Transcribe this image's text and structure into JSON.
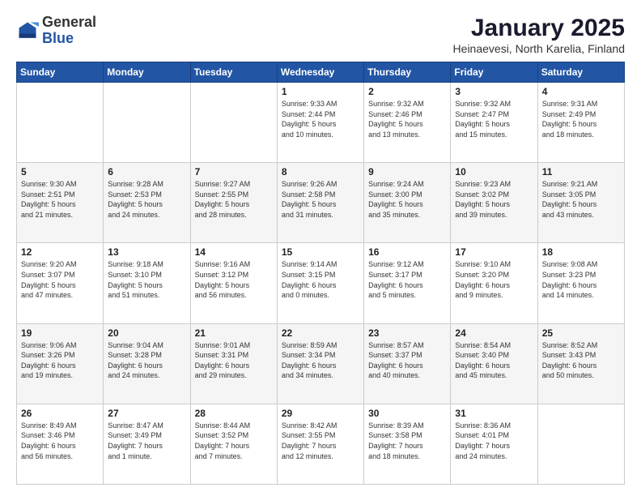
{
  "header": {
    "logo": {
      "general": "General",
      "blue": "Blue"
    },
    "title": "January 2025",
    "subtitle": "Heinaevesi, North Karelia, Finland"
  },
  "weekdays": [
    "Sunday",
    "Monday",
    "Tuesday",
    "Wednesday",
    "Thursday",
    "Friday",
    "Saturday"
  ],
  "weeks": [
    [
      {
        "day": "",
        "info": ""
      },
      {
        "day": "",
        "info": ""
      },
      {
        "day": "",
        "info": ""
      },
      {
        "day": "1",
        "info": "Sunrise: 9:33 AM\nSunset: 2:44 PM\nDaylight: 5 hours\nand 10 minutes."
      },
      {
        "day": "2",
        "info": "Sunrise: 9:32 AM\nSunset: 2:46 PM\nDaylight: 5 hours\nand 13 minutes."
      },
      {
        "day": "3",
        "info": "Sunrise: 9:32 AM\nSunset: 2:47 PM\nDaylight: 5 hours\nand 15 minutes."
      },
      {
        "day": "4",
        "info": "Sunrise: 9:31 AM\nSunset: 2:49 PM\nDaylight: 5 hours\nand 18 minutes."
      }
    ],
    [
      {
        "day": "5",
        "info": "Sunrise: 9:30 AM\nSunset: 2:51 PM\nDaylight: 5 hours\nand 21 minutes."
      },
      {
        "day": "6",
        "info": "Sunrise: 9:28 AM\nSunset: 2:53 PM\nDaylight: 5 hours\nand 24 minutes."
      },
      {
        "day": "7",
        "info": "Sunrise: 9:27 AM\nSunset: 2:55 PM\nDaylight: 5 hours\nand 28 minutes."
      },
      {
        "day": "8",
        "info": "Sunrise: 9:26 AM\nSunset: 2:58 PM\nDaylight: 5 hours\nand 31 minutes."
      },
      {
        "day": "9",
        "info": "Sunrise: 9:24 AM\nSunset: 3:00 PM\nDaylight: 5 hours\nand 35 minutes."
      },
      {
        "day": "10",
        "info": "Sunrise: 9:23 AM\nSunset: 3:02 PM\nDaylight: 5 hours\nand 39 minutes."
      },
      {
        "day": "11",
        "info": "Sunrise: 9:21 AM\nSunset: 3:05 PM\nDaylight: 5 hours\nand 43 minutes."
      }
    ],
    [
      {
        "day": "12",
        "info": "Sunrise: 9:20 AM\nSunset: 3:07 PM\nDaylight: 5 hours\nand 47 minutes."
      },
      {
        "day": "13",
        "info": "Sunrise: 9:18 AM\nSunset: 3:10 PM\nDaylight: 5 hours\nand 51 minutes."
      },
      {
        "day": "14",
        "info": "Sunrise: 9:16 AM\nSunset: 3:12 PM\nDaylight: 5 hours\nand 56 minutes."
      },
      {
        "day": "15",
        "info": "Sunrise: 9:14 AM\nSunset: 3:15 PM\nDaylight: 6 hours\nand 0 minutes."
      },
      {
        "day": "16",
        "info": "Sunrise: 9:12 AM\nSunset: 3:17 PM\nDaylight: 6 hours\nand 5 minutes."
      },
      {
        "day": "17",
        "info": "Sunrise: 9:10 AM\nSunset: 3:20 PM\nDaylight: 6 hours\nand 9 minutes."
      },
      {
        "day": "18",
        "info": "Sunrise: 9:08 AM\nSunset: 3:23 PM\nDaylight: 6 hours\nand 14 minutes."
      }
    ],
    [
      {
        "day": "19",
        "info": "Sunrise: 9:06 AM\nSunset: 3:26 PM\nDaylight: 6 hours\nand 19 minutes."
      },
      {
        "day": "20",
        "info": "Sunrise: 9:04 AM\nSunset: 3:28 PM\nDaylight: 6 hours\nand 24 minutes."
      },
      {
        "day": "21",
        "info": "Sunrise: 9:01 AM\nSunset: 3:31 PM\nDaylight: 6 hours\nand 29 minutes."
      },
      {
        "day": "22",
        "info": "Sunrise: 8:59 AM\nSunset: 3:34 PM\nDaylight: 6 hours\nand 34 minutes."
      },
      {
        "day": "23",
        "info": "Sunrise: 8:57 AM\nSunset: 3:37 PM\nDaylight: 6 hours\nand 40 minutes."
      },
      {
        "day": "24",
        "info": "Sunrise: 8:54 AM\nSunset: 3:40 PM\nDaylight: 6 hours\nand 45 minutes."
      },
      {
        "day": "25",
        "info": "Sunrise: 8:52 AM\nSunset: 3:43 PM\nDaylight: 6 hours\nand 50 minutes."
      }
    ],
    [
      {
        "day": "26",
        "info": "Sunrise: 8:49 AM\nSunset: 3:46 PM\nDaylight: 6 hours\nand 56 minutes."
      },
      {
        "day": "27",
        "info": "Sunrise: 8:47 AM\nSunset: 3:49 PM\nDaylight: 7 hours\nand 1 minute."
      },
      {
        "day": "28",
        "info": "Sunrise: 8:44 AM\nSunset: 3:52 PM\nDaylight: 7 hours\nand 7 minutes."
      },
      {
        "day": "29",
        "info": "Sunrise: 8:42 AM\nSunset: 3:55 PM\nDaylight: 7 hours\nand 12 minutes."
      },
      {
        "day": "30",
        "info": "Sunrise: 8:39 AM\nSunset: 3:58 PM\nDaylight: 7 hours\nand 18 minutes."
      },
      {
        "day": "31",
        "info": "Sunrise: 8:36 AM\nSunset: 4:01 PM\nDaylight: 7 hours\nand 24 minutes."
      },
      {
        "day": "",
        "info": ""
      }
    ]
  ]
}
